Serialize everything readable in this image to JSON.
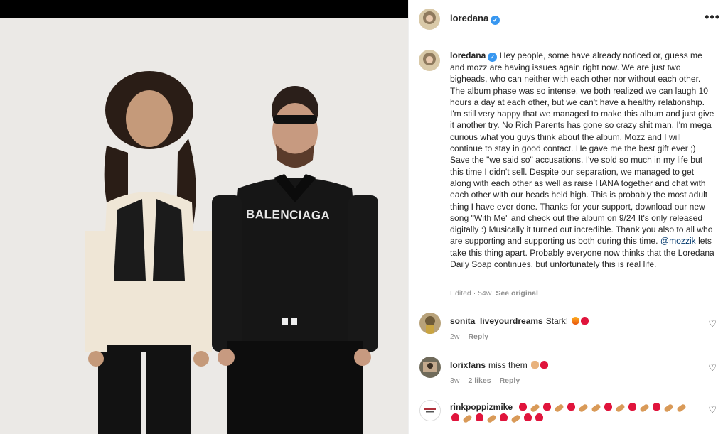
{
  "post": {
    "username": "loredana",
    "verified_icon": "verified-badge-icon",
    "more_icon": "more-options-icon",
    "caption_text": "Hey people, some have already noticed or, guess me and mozz are having issues again right now. We are just two bigheads, who can neither with each other nor without each other. The album phase was so intense, we both realized we can laugh 10 hours a day at each other, but we can't have a healthy relationship. I'm still very happy that we managed to make this album and just give it another try. No Rich Parents has gone so crazy shit man. I'm mega curious what you guys think about the album. Mozz and I will continue to stay in good contact. He gave me the best gift ever ;) Save the \"we said so\" accusations. I've sold so much in my life but this time I didn't sell. Despite our separation, we managed to get along with each other as well as raise HANA together and chat with each other with our heads held high. This is probably the most adult thing I have ever done. Thanks for your support, download our new song \"With Me\" and check out the album on 9/24 It's only released digitally :) Musically it turned out incredible. Thank you also to all who are supporting and supporting us both during this time.",
    "caption_mention": "@mozzik",
    "caption_text_end": "lets take this thing apart. Probably everyone now thinks that the Loredana Daily Soap continues, but unfortunately this is real life.",
    "edited": "Edited",
    "age": "54w",
    "see_original": "See original"
  },
  "photo": {
    "jacket_text": "BALENCIAGA"
  },
  "comments": [
    {
      "username": "sonita_liveyourdreams",
      "text": "Stark!",
      "emojis": [
        "fire",
        "red-heart"
      ],
      "time": "2w",
      "likes": "",
      "reply": "Reply"
    },
    {
      "username": "lorixfans",
      "text": "miss them",
      "emojis": [
        "hand",
        "red-heart"
      ],
      "time": "3w",
      "likes": "2 likes",
      "reply": "Reply"
    },
    {
      "username": "rinkpoppizmike",
      "text": "",
      "emojis": [
        "red-heart",
        "hotdog",
        "red-heart",
        "hotdog",
        "red-heart",
        "hotdog",
        "hotdog",
        "red-heart",
        "hotdog",
        "red-heart",
        "hotdog",
        "red-heart",
        "hotdog",
        "hotdog",
        "red-heart",
        "hotdog",
        "red-heart",
        "hotdog",
        "red-heart",
        "hotdog",
        "red-heart",
        "red-heart"
      ],
      "time": "",
      "likes": "",
      "reply": ""
    }
  ],
  "colors": {
    "link": "#00376b",
    "muted": "#8e8e8e",
    "verified": "#3897f0",
    "heart": "#e0143c"
  }
}
